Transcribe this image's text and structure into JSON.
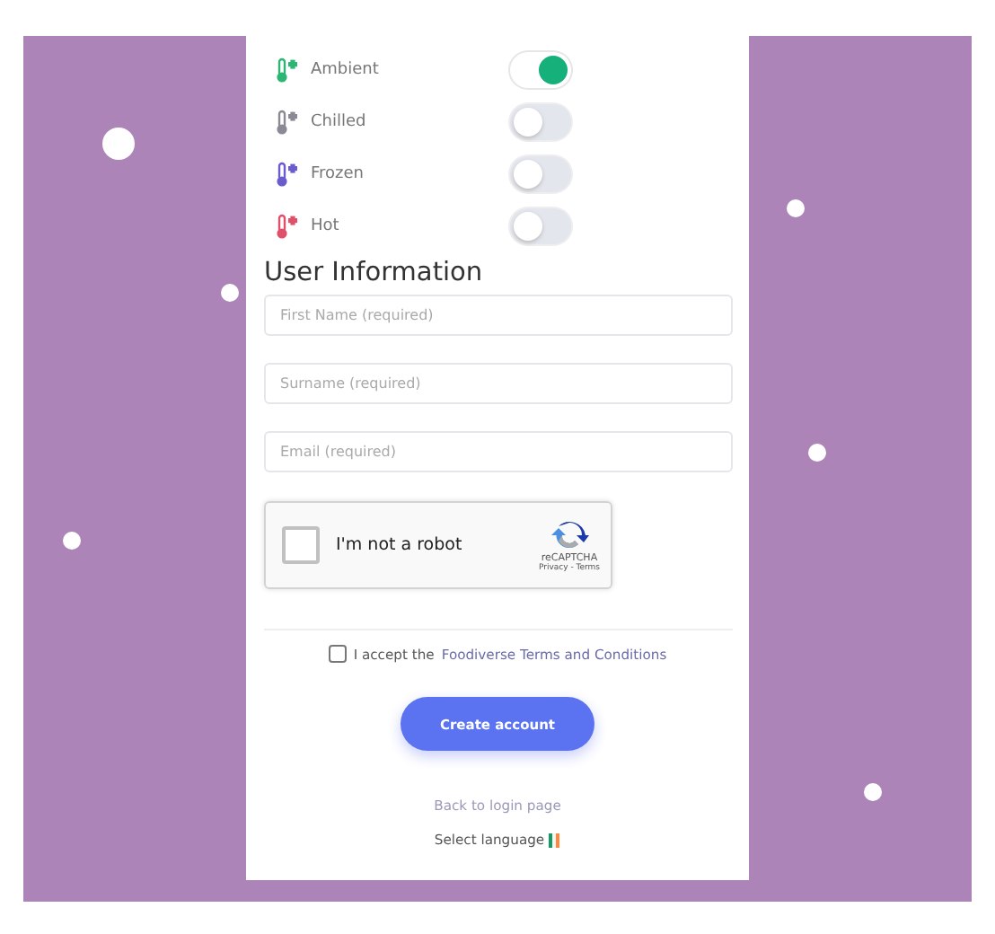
{
  "temperatures": [
    {
      "label": "Ambient",
      "on": true,
      "color": "#2bb673"
    },
    {
      "label": "Chilled",
      "on": false,
      "color": "#8a8a95"
    },
    {
      "label": "Frozen",
      "on": false,
      "color": "#6a5ccf"
    },
    {
      "label": "Hot",
      "on": false,
      "color": "#e0506a"
    }
  ],
  "section_title": "User Information",
  "fields": [
    {
      "placeholder": "First Name (required)"
    },
    {
      "placeholder": "Surname (required)"
    },
    {
      "placeholder": "Email (required)"
    }
  ],
  "captcha": {
    "label": "I'm not a robot",
    "checked": false,
    "brand": "reCAPTCHA",
    "links": "Privacy - Terms"
  },
  "terms": {
    "checked": false,
    "prefix": "I accept the",
    "link": "Foodiverse Terms and Conditions"
  },
  "create_button": "Create account",
  "back_link": "Back to login page",
  "language": {
    "label": "Select language"
  }
}
